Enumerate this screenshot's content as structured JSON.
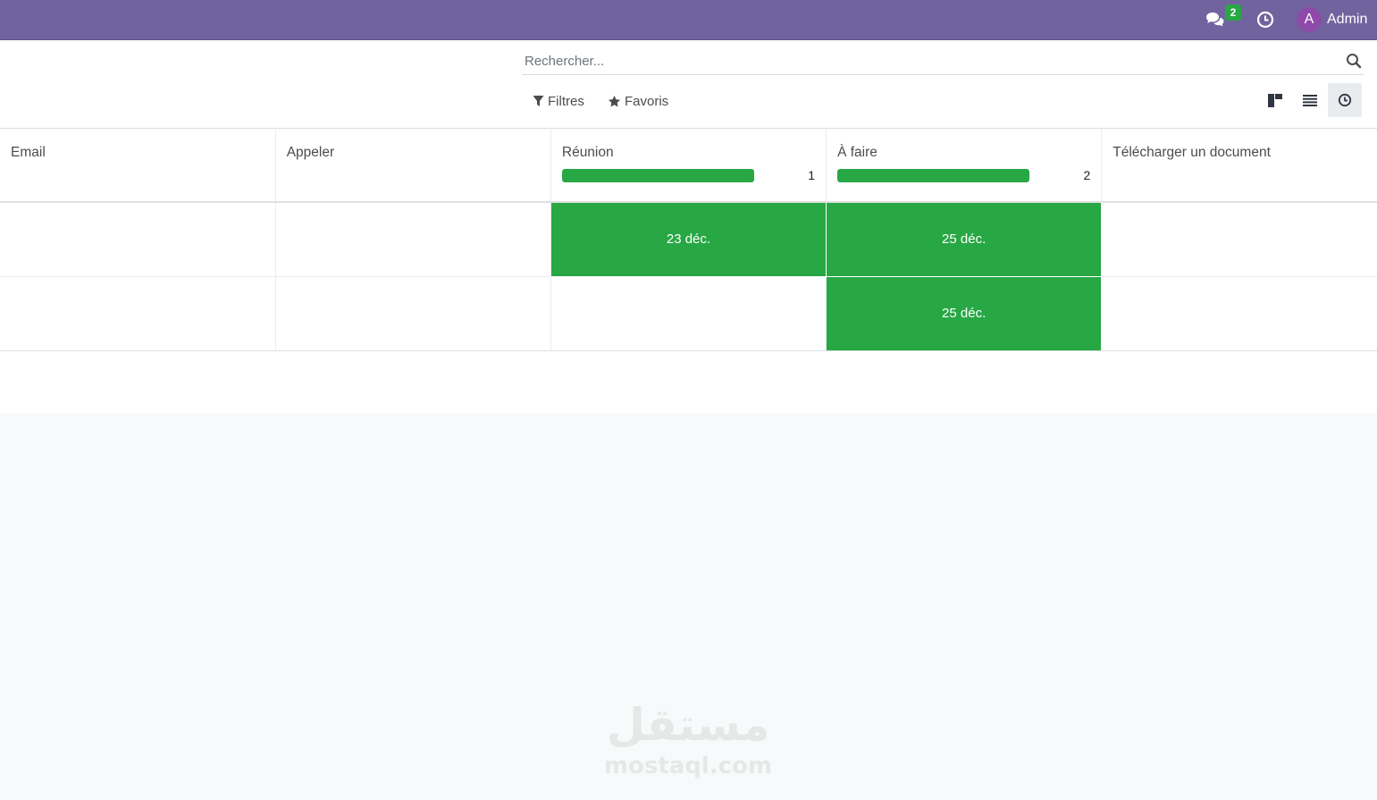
{
  "navbar": {
    "messages_badge": "2",
    "user_initial": "A",
    "user_name": "Admin",
    "background": "#71639e"
  },
  "search": {
    "placeholder": "Rechercher..."
  },
  "toolbar": {
    "filters_label": "Filtres",
    "favorites_label": "Favoris"
  },
  "views": [
    "kanban-icon",
    "list-icon",
    "activity-icon"
  ],
  "active_view": "activity",
  "columns": [
    {
      "title": "Email"
    },
    {
      "title": "Appeler"
    },
    {
      "title": "Réunion",
      "count": "1",
      "progress": 1.0
    },
    {
      "title": "À faire",
      "count": "2",
      "progress": 1.0
    },
    {
      "title": "Télécharger un document"
    }
  ],
  "rows": [
    {
      "cells": [
        "",
        "",
        "23 déc.",
        "25 déc.",
        ""
      ]
    },
    {
      "cells": [
        "",
        "",
        "",
        "25 déc.",
        ""
      ]
    }
  ],
  "colors": {
    "planned": "#28a745",
    "accent": "#71639e"
  },
  "watermark": {
    "arabic": "مستقل",
    "latin": "mostaql.com"
  }
}
